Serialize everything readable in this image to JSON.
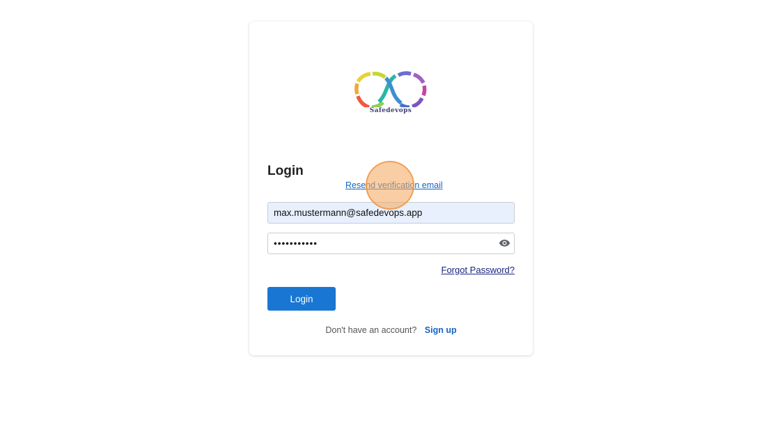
{
  "logo": {
    "brand_name": "Safedevops"
  },
  "login_form": {
    "title": "Login",
    "resend_link": "Resend verification email",
    "email_value": "max.mustermann@safedevops.app",
    "password_value": "•••••••••••",
    "show_password_icon": "eye-icon",
    "forgot_password_link": "Forgot Password?",
    "login_button": "Login",
    "signup_prompt": "Don't have an account?",
    "signup_link": "Sign up"
  },
  "colors": {
    "primary_button": "#1976d2",
    "link": "#1565c0",
    "autofill_background": "#e8f0fe",
    "click_marker": "#f5a65b"
  }
}
